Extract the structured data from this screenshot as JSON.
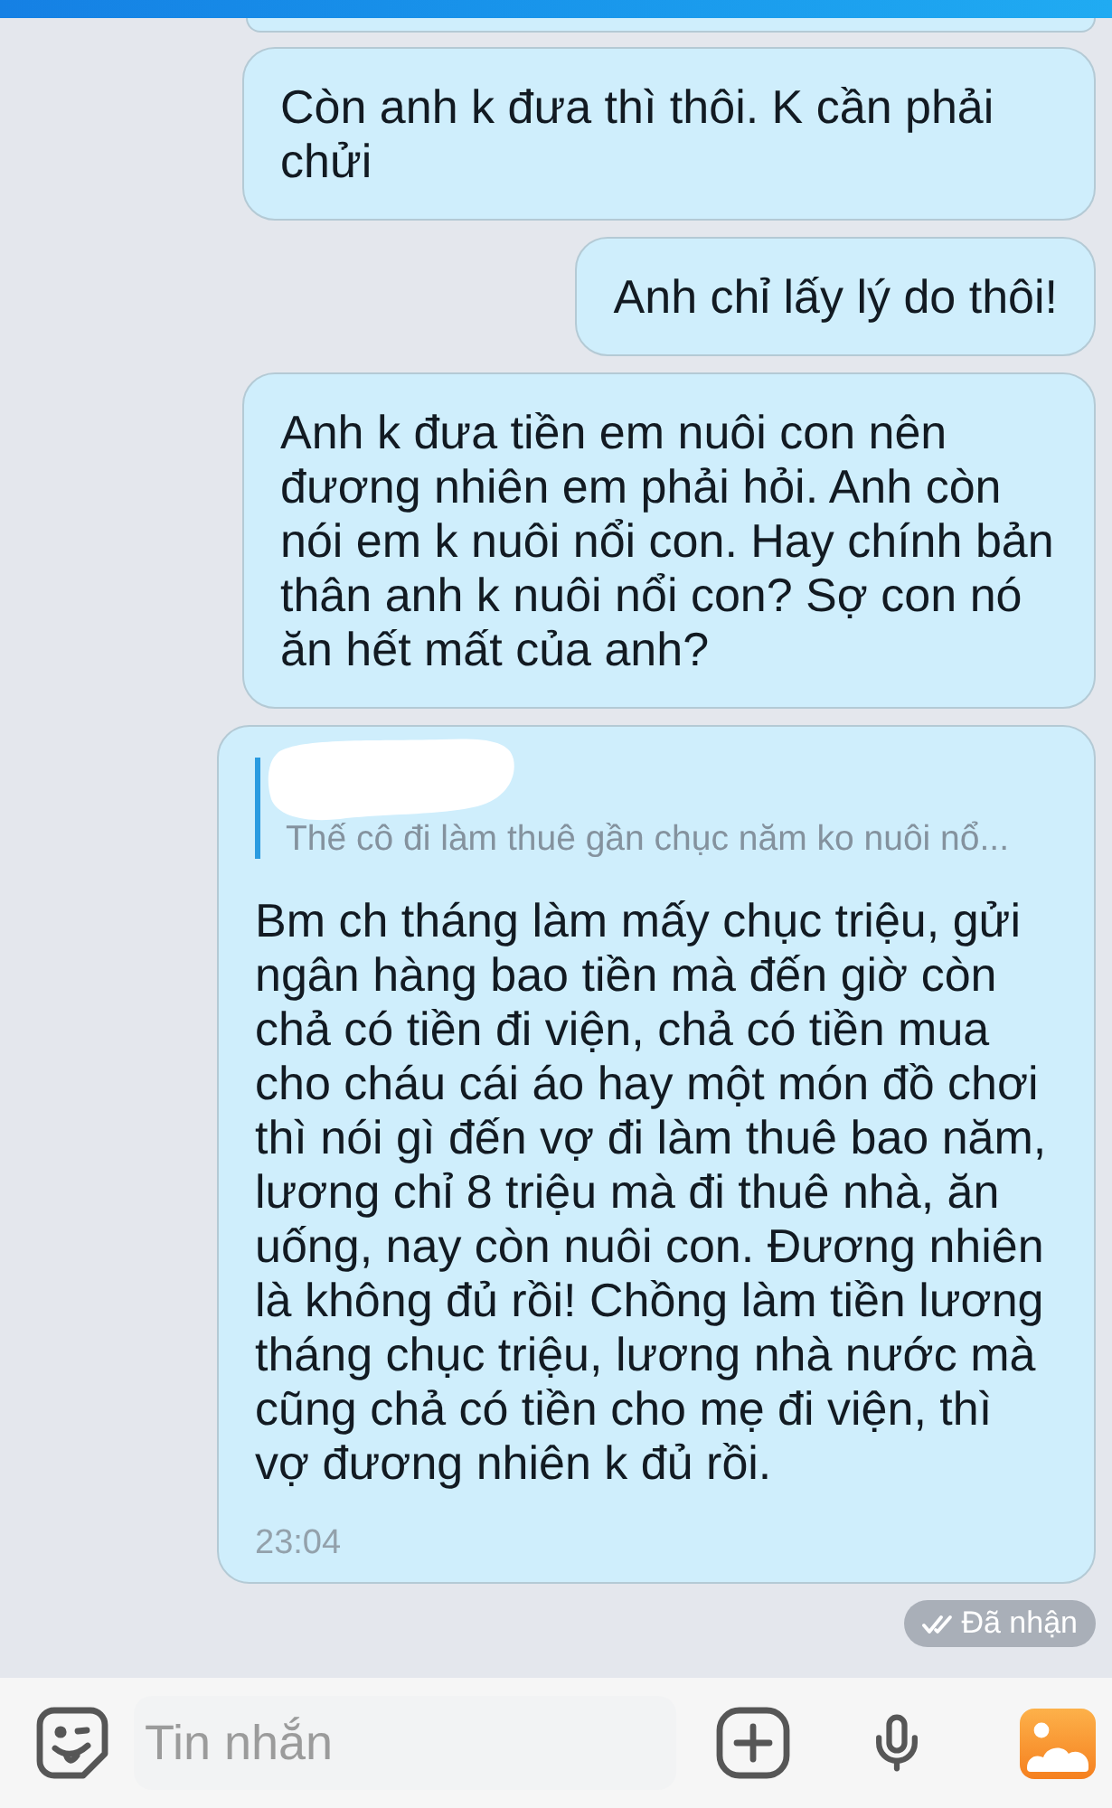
{
  "messages": [
    {
      "kind": "text",
      "text": "Còn anh k đưa thì thôi. K cần phải chửi"
    },
    {
      "kind": "text",
      "text": "Anh chỉ lấy lý do thôi!"
    },
    {
      "kind": "text",
      "text": "Anh k đưa tiền em nuôi con nên đương nhiên em phải hỏi. Anh còn nói em k nuôi nổi con. Hay chính bản thân anh k nuôi nổi con? Sợ con nó ăn hết mất của anh?"
    },
    {
      "kind": "reply",
      "quote": "Thế cô đi làm thuê gần chục năm ko nuôi nổ...",
      "text": "Bm ch tháng làm mấy chục triệu, gửi ngân hàng bao tiền mà đến giờ còn chả có tiền đi viện, chả có tiền mua cho cháu cái áo hay một món đồ chơi thì nói gì đến vợ đi làm thuê bao năm, lương chỉ 8 triệu mà đi thuê nhà, ăn uống, nay còn nuôi con. Đương nhiên là không đủ rồi! Chồng làm tiền lương tháng chục triệu, lương nhà nước mà cũng chả có tiền cho mẹ đi viện, thì vợ đương nhiên k đủ rồi.",
      "time": "23:04"
    }
  ],
  "delivery_status": "Đã nhận",
  "composer": {
    "placeholder": "Tin nhắn"
  }
}
